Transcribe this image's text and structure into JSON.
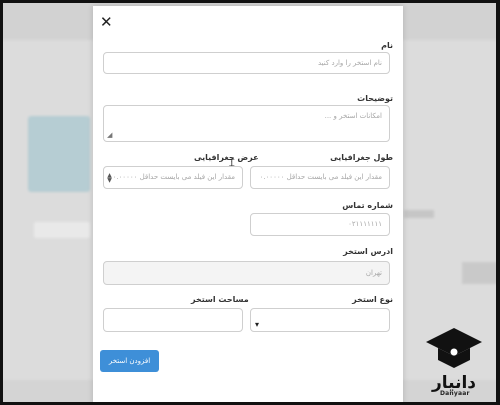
{
  "modal": {
    "fields": {
      "name": {
        "label": "نام",
        "placeholder": "نام استخر را وارد کنید"
      },
      "description": {
        "label": "توضیحات",
        "placeholder": "امکانات استخر و ..."
      },
      "longitude": {
        "label": "طول جغرافیایی",
        "placeholder": "مقدار این فیلد می بایست حداقل ۰.۰۰۰۰۰ "
      },
      "latitude": {
        "label": "عرض جغرافیایی",
        "placeholder": "مقدار این فیلد می بایست حداقل ۰.۰۰۰۰۰ "
      },
      "phone": {
        "label": "شماره تماس",
        "placeholder": "۰۲۱۱۱۱۱۱۱"
      },
      "address": {
        "label": "ادرس استخر",
        "placeholder": "تهران"
      },
      "pool_type": {
        "label": "نوع استخر",
        "value": ""
      },
      "pool_area": {
        "label": "مساحت استخر",
        "value": ""
      }
    },
    "submit_label": "افزودن استخر"
  },
  "watermark": {
    "brand_fa": "دانیار",
    "brand_en": "Danyaar"
  },
  "colors": {
    "accent": "#3e8fd8"
  }
}
